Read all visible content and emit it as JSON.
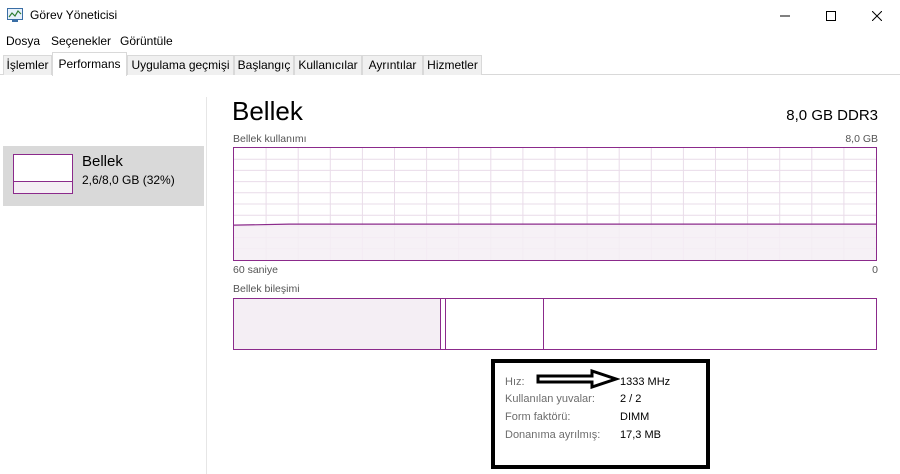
{
  "window": {
    "title": "Görev Yöneticisi",
    "icon": "task-manager-icon"
  },
  "menu": {
    "items": [
      "Dosya",
      "Seçenekler",
      "Görüntüle"
    ]
  },
  "tabs": [
    {
      "label": "İşlemler",
      "active": false
    },
    {
      "label": "Performans",
      "active": true
    },
    {
      "label": "Uygulama geçmişi",
      "active": false
    },
    {
      "label": "Başlangıç",
      "active": false
    },
    {
      "label": "Kullanıcılar",
      "active": false
    },
    {
      "label": "Ayrıntılar",
      "active": false
    },
    {
      "label": "Hizmetler",
      "active": false
    }
  ],
  "sidebar": {
    "items": [
      {
        "title": "Bellek",
        "subtitle": "2,6/8,0 GB (32%)",
        "selected": true
      }
    ]
  },
  "main": {
    "title": "Bellek",
    "model": "8,0 GB DDR3",
    "usage_label": "Bellek kullanımı",
    "usage_max": "8,0 GB",
    "time_left": "60 saniye",
    "time_right": "0",
    "composition_label": "Bellek bileşimi",
    "usage_fraction": 0.32
  },
  "stats": [
    {
      "label": "Hız:",
      "value": "1333 MHz"
    },
    {
      "label": "Kullanılan yuvalar:",
      "value": "2 / 2"
    },
    {
      "label": "Form faktörü:",
      "value": "DIMM"
    },
    {
      "label": "Donanıma ayrılmış:",
      "value": "17,3 MB"
    }
  ],
  "colors": {
    "accent": "#8b2a8b",
    "accent_fill": "#f4eef4",
    "selected_bg": "#d9d9d9",
    "grid": "#e9dce9"
  }
}
